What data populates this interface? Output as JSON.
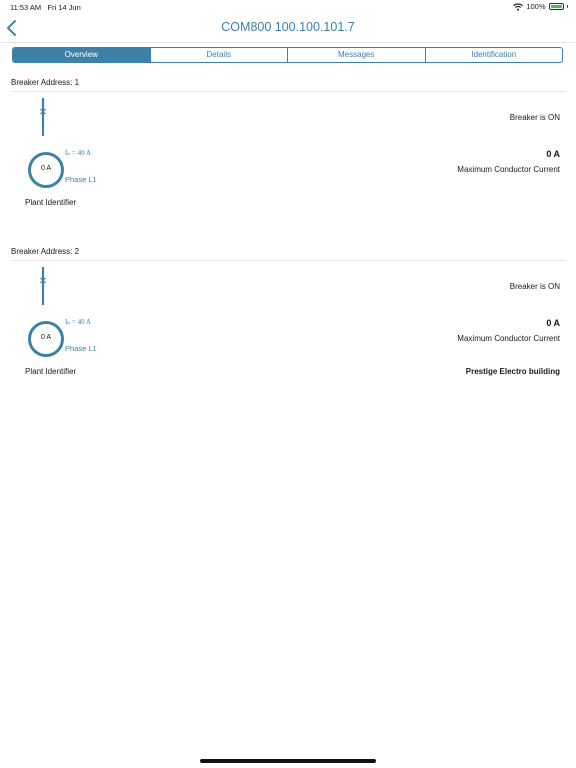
{
  "status_bar": {
    "time": "11:53 AM",
    "date": "Fri 14 Jun",
    "battery": "100%",
    "icons": [
      "wifi-icon",
      "battery-icon"
    ]
  },
  "nav": {
    "back_icon": "chevron-left-icon",
    "title": "COM800 100.100.101.7"
  },
  "tabs": [
    {
      "label": "Overview",
      "active": true
    },
    {
      "label": "Details",
      "active": false
    },
    {
      "label": "Messages",
      "active": false
    },
    {
      "label": "Identification",
      "active": false
    }
  ],
  "colors": {
    "accent": "#3d80a8",
    "battery_green": "#34c759"
  },
  "breakers": [
    {
      "title": "Breaker Address: 1",
      "state": "Breaker is ON",
      "gauge_value": "0 A",
      "rated_current": "Iₙ = 40 A",
      "phase": "Phase L1",
      "current_value": "0 A",
      "current_label": "Maximum Conductor Current",
      "plant_label": "Plant Identifier",
      "plant_value": ""
    },
    {
      "title": "Breaker Address: 2",
      "state": "Breaker is ON",
      "gauge_value": "0 A",
      "rated_current": "Iₙ = 40 A",
      "phase": "Phase L1",
      "current_value": "0 A",
      "current_label": "Maximum Conductor Current",
      "plant_label": "Plant Identifier",
      "plant_value": "Prestige Electro building"
    }
  ]
}
